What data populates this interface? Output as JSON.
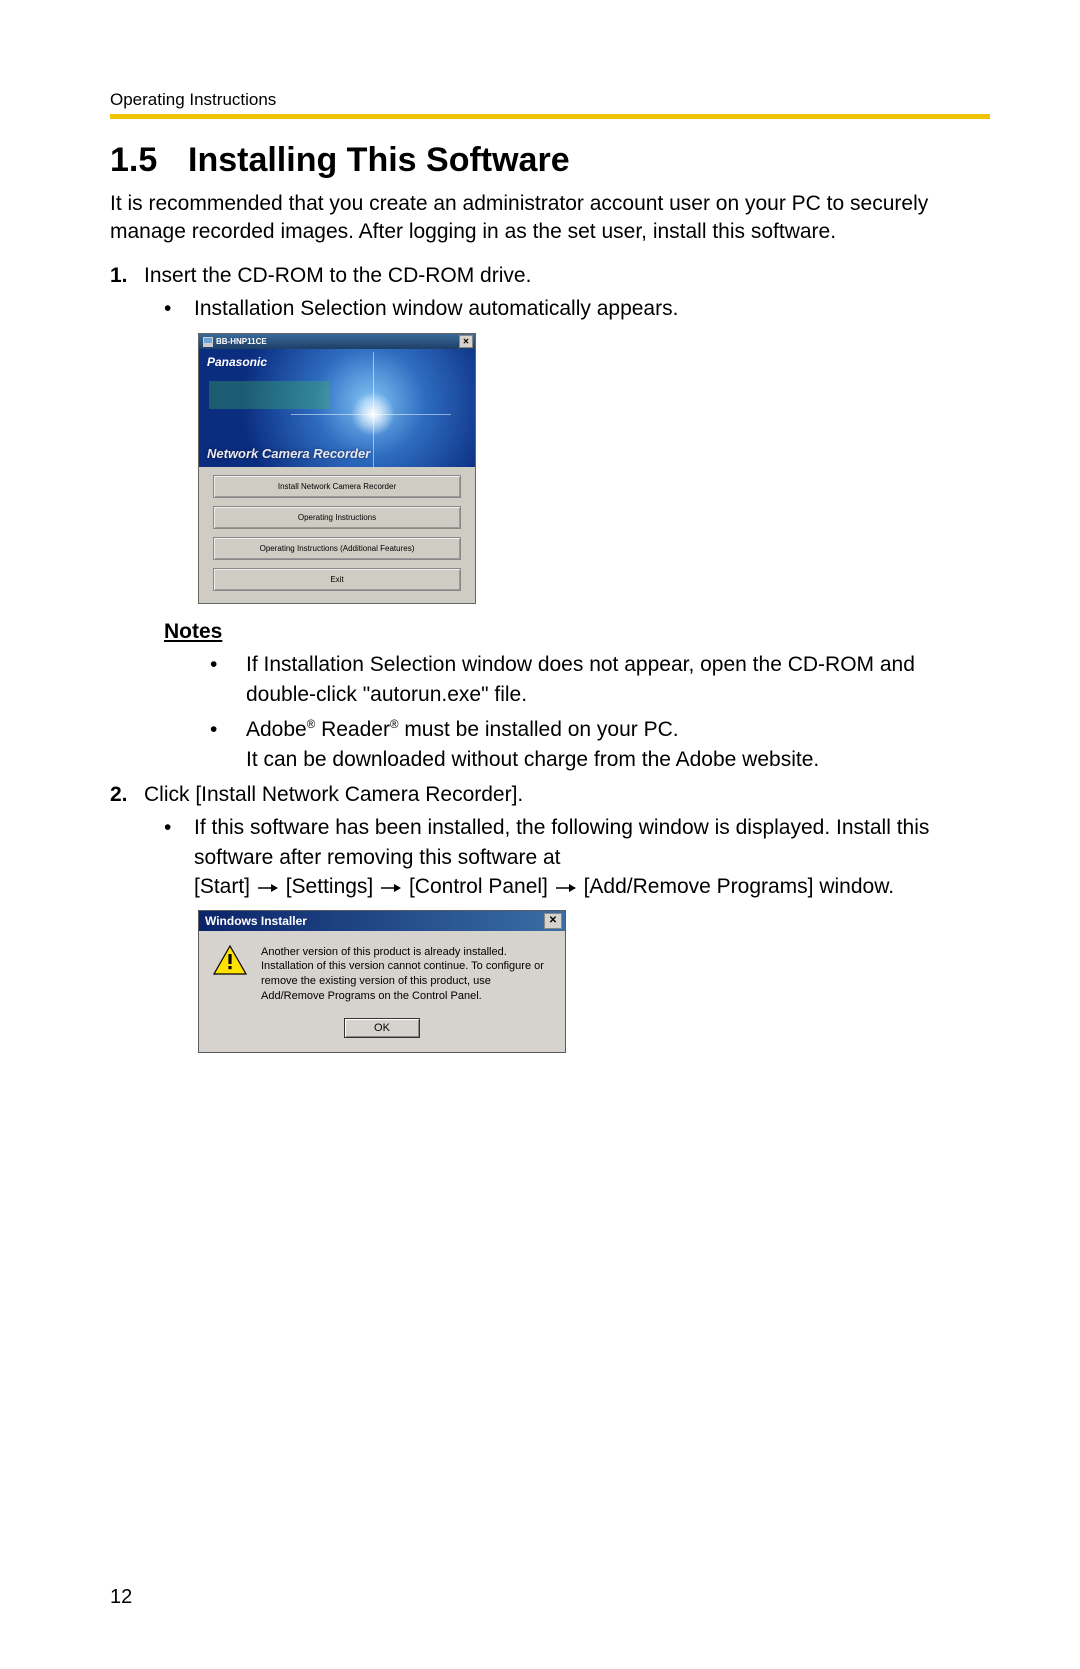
{
  "header_label": "Operating Instructions",
  "section": {
    "number": "1.5",
    "title": "Installing This Software"
  },
  "intro": "It is recommended that you create an administrator account user on your PC to securely manage recorded images. After logging in as the set user, install this software.",
  "step1": {
    "marker": "1.",
    "text": "Insert the CD-ROM to the CD-ROM drive.",
    "sub": "Installation Selection window automatically appears."
  },
  "installer": {
    "titlebar": "BB-HNP11CE",
    "brand": "Panasonic",
    "banner_title": "Network Camera Recorder",
    "buttons": [
      "Install Network Camera Recorder",
      "Operating Instructions",
      "Operating Instructions (Additional Features)",
      "Exit"
    ]
  },
  "notes_heading": "Notes",
  "notes": {
    "n1": "If Installation Selection window does not appear, open the CD-ROM and double-click \"autorun.exe\" file.",
    "n2a": "Adobe",
    "n2b": " Reader",
    "n2c": " must be installed on your PC.",
    "n2d": "It can be downloaded  without charge from the Adobe website."
  },
  "step2": {
    "marker": "2.",
    "text": "Click [Install Network Camera Recorder].",
    "sub_a": "If this software has been installed, the following window is displayed. Install this software after removing this software at",
    "path": {
      "p1": "[Start]",
      "p2": "[Settings]",
      "p3": "[Control Panel]",
      "p4": "[Add/Remove Programs] window."
    }
  },
  "win_dialog": {
    "title": "Windows Installer",
    "message": "Another version of this product is already installed. Installation of this version cannot continue. To configure or remove the existing version of this product, use Add/Remove Programs on the Control Panel.",
    "ok": "OK"
  },
  "page_number": "12",
  "reg": "®"
}
